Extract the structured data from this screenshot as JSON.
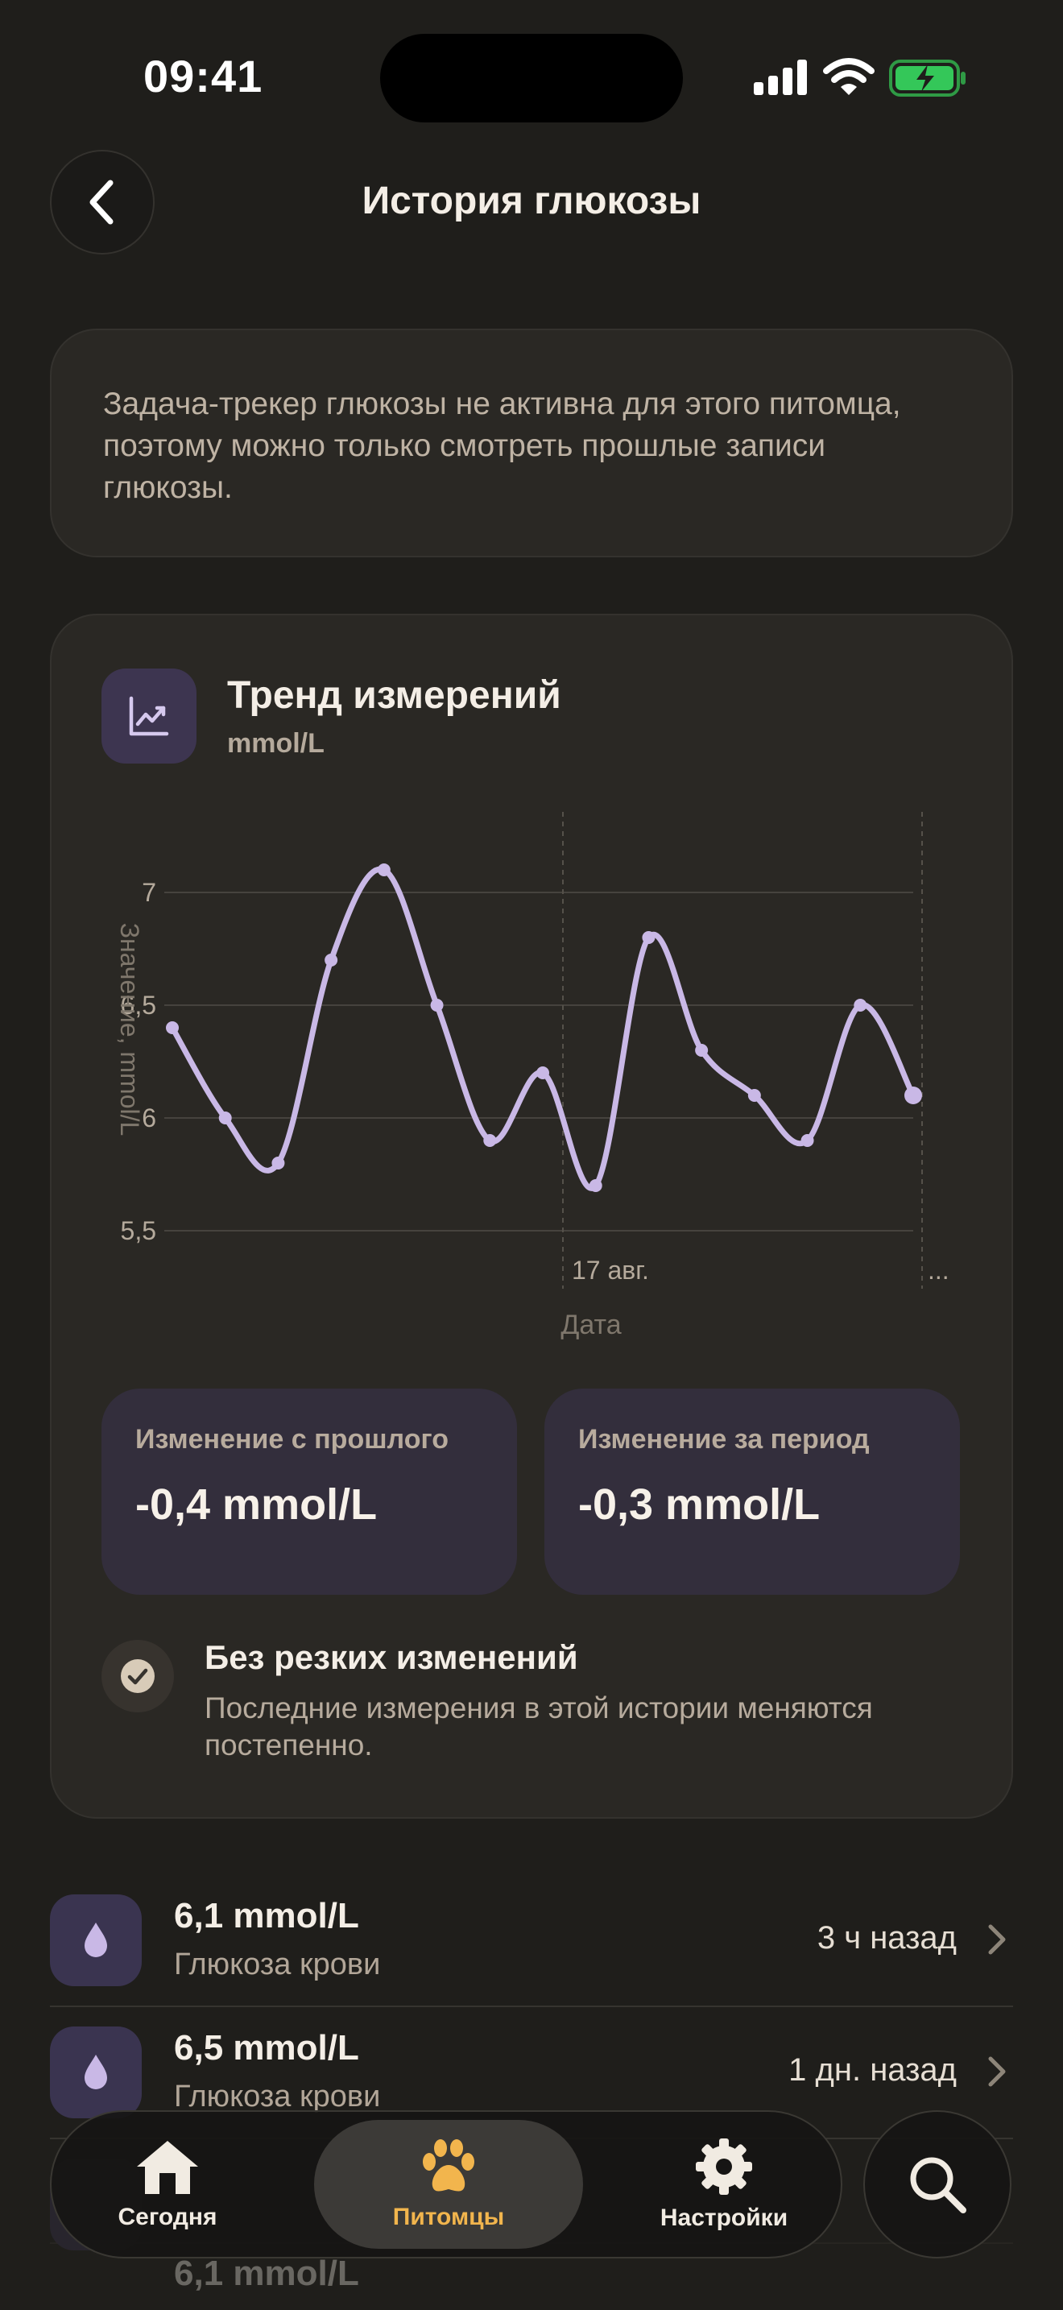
{
  "status": {
    "time": "09:41"
  },
  "header": {
    "title": "История глюкозы"
  },
  "notice": {
    "text": "Задача-трекер глюкозы не активна для этого питомца, поэтому можно только смотреть прошлые записи глюкозы."
  },
  "trend": {
    "title": "Тренд измерений",
    "unit": "mmol/L",
    "stats": [
      {
        "label": "Изменение с прошлого",
        "value": "-0,4 mmol/L"
      },
      {
        "label": "Изменение за период",
        "value": "-0,3 mmol/L"
      }
    ],
    "note_title": "Без резких изменений",
    "note_text": "Последние измерения в этой истории меняются постепенно."
  },
  "chart_data": {
    "type": "line",
    "ylabel": "Значение, mmol/L",
    "xlabel": "Дата",
    "y_ticks": [
      "7",
      "6,5",
      "6",
      "5,5"
    ],
    "y_tick_values": [
      7,
      6.5,
      6,
      5.5
    ],
    "ylim": [
      5.5,
      7
    ],
    "x_tick_labels": [
      "17 авг.",
      "..."
    ],
    "grid": true,
    "series": [
      {
        "values": [
          6.4,
          6.0,
          5.8,
          6.7,
          7.1,
          6.5,
          5.9,
          6.2,
          5.7,
          6.8,
          6.3,
          6.1,
          5.9,
          6.5,
          6.1
        ]
      }
    ],
    "colors": {
      "line": "#c9b8e6",
      "grid": "#46433e"
    }
  },
  "history": [
    {
      "value": "6,1 mmol/L",
      "type": "Глюкоза крови",
      "time": "3 ч назад"
    },
    {
      "value": "6,5 mmol/L",
      "type": "Глюкоза крови",
      "time": "1 дн. назад"
    },
    {
      "value": "6,1 mmol/L"
    }
  ],
  "tabs": [
    {
      "label": "Сегодня",
      "icon": "home-icon"
    },
    {
      "label": "Питомцы",
      "icon": "paw-icon",
      "active": true
    },
    {
      "label": "Настройки",
      "icon": "gear-icon"
    }
  ],
  "colors": {
    "accent": "#f2b54d",
    "chart_line": "#c9b8e6",
    "background": "#1f1e1b"
  }
}
